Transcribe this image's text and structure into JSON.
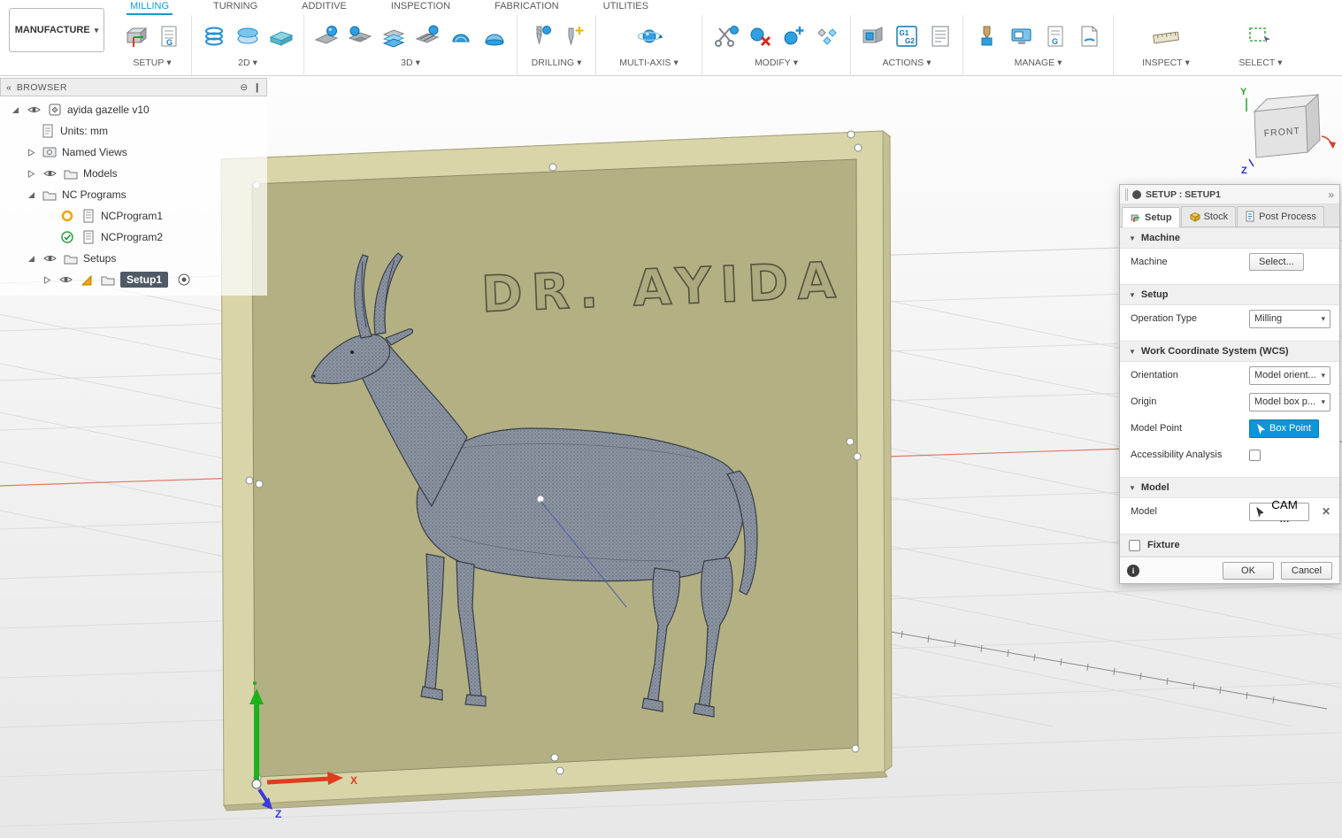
{
  "icons": {
    "caret_down": "▾",
    "collapse_left": "«",
    "circle_minus": "⊖",
    "handle": "❙",
    "detach": "»",
    "close": "✕",
    "info": "i",
    "section_caret": "▼",
    "g": "G",
    "g1": "G1",
    "g2": "G2"
  },
  "toolbar": {
    "workspace_button": "MANUFACTURE",
    "tabs": [
      {
        "label": "MILLING",
        "active": true
      },
      {
        "label": "TURNING",
        "active": false
      },
      {
        "label": "ADDITIVE",
        "active": false
      },
      {
        "label": "INSPECTION",
        "active": false
      },
      {
        "label": "FABRICATION",
        "active": false
      },
      {
        "label": "UTILITIES",
        "active": false
      }
    ],
    "groups": [
      {
        "label": "SETUP"
      },
      {
        "label": "2D"
      },
      {
        "label": "3D"
      },
      {
        "label": "DRILLING"
      },
      {
        "label": "MULTI-AXIS"
      },
      {
        "label": "MODIFY"
      },
      {
        "label": "ACTIONS"
      },
      {
        "label": "MANAGE"
      },
      {
        "label": "INSPECT"
      },
      {
        "label": "SELECT"
      }
    ]
  },
  "browser": {
    "title": "BROWSER",
    "items": [
      {
        "label": "ayida gazelle v10"
      },
      {
        "label": "Units: mm"
      },
      {
        "label": "Named Views"
      },
      {
        "label": "Models"
      },
      {
        "label": "NC Programs"
      },
      {
        "label": "NCProgram1"
      },
      {
        "label": "NCProgram2"
      },
      {
        "label": "Setups"
      },
      {
        "label": "Setup1"
      }
    ]
  },
  "viewport": {
    "engraving_text": "DR. AYIDA",
    "viewcube": {
      "front": "FRONT"
    },
    "axes": {
      "x": "X",
      "y": "Y",
      "z": "Z"
    }
  },
  "dialog": {
    "title": "SETUP : SETUP1",
    "tabs": [
      {
        "label": "Setup"
      },
      {
        "label": "Stock"
      },
      {
        "label": "Post Process"
      }
    ],
    "machine": {
      "title": "Machine",
      "machine_label": "Machine",
      "select_button": "Select..."
    },
    "setup": {
      "title": "Setup",
      "operation_type_label": "Operation Type",
      "operation_type_value": "Milling"
    },
    "wcs": {
      "title": "Work Coordinate System (WCS)",
      "orientation_label": "Orientation",
      "orientation_value": "Model orient...",
      "origin_label": "Origin",
      "origin_value": "Model box p...",
      "model_point_label": "Model Point",
      "model_point_value": "Box Point",
      "accessibility_label": "Accessibility Analysis"
    },
    "model": {
      "title": "Model",
      "model_label": "Model",
      "model_value": "CAM ..."
    },
    "fixture": {
      "title": "Fixture"
    },
    "footer": {
      "ok": "OK",
      "cancel": "Cancel"
    }
  }
}
